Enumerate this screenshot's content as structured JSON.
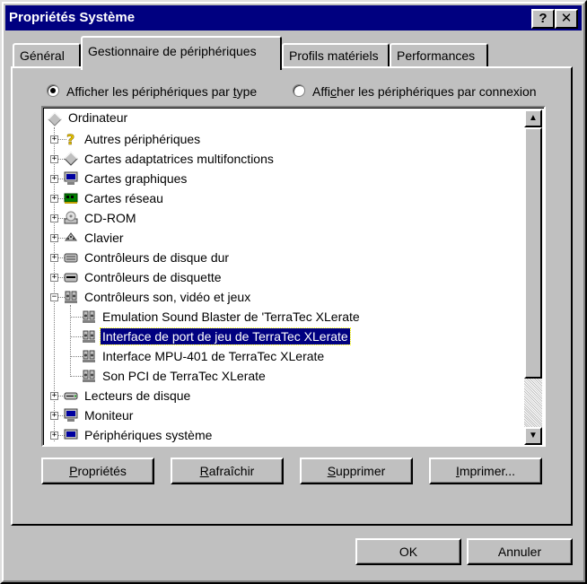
{
  "window": {
    "title": "Propriétés Système",
    "help_label": "?",
    "close_label": "✕"
  },
  "tabs": [
    {
      "label": "Général",
      "active": false
    },
    {
      "label": "Gestionnaire de périphériques",
      "active": true
    },
    {
      "label": "Profils matériels",
      "active": false
    },
    {
      "label": "Performances",
      "active": false
    }
  ],
  "view_options": {
    "by_type": {
      "pre": "Afficher les périphériques par ",
      "u": "t",
      "post": "ype",
      "checked": true
    },
    "by_connection": {
      "pre": "Affi",
      "u": "c",
      "post": "her les périphériques par connexion",
      "checked": false
    }
  },
  "tree": {
    "root": "Ordinateur",
    "items": [
      {
        "label": "Autres périphériques",
        "icon": "question-icon"
      },
      {
        "label": "Cartes adaptatrices multifonctions",
        "icon": "diamond-icon"
      },
      {
        "label": "Cartes graphiques",
        "icon": "monitor-icon"
      },
      {
        "label": "Cartes réseau",
        "icon": "network-card-icon"
      },
      {
        "label": "CD-ROM",
        "icon": "cdrom-icon"
      },
      {
        "label": "Clavier",
        "icon": "keyboard-icon"
      },
      {
        "label": "Contrôleurs de disque dur",
        "icon": "disk-controller-icon"
      },
      {
        "label": "Contrôleurs de disquette",
        "icon": "floppy-controller-icon"
      },
      {
        "label": "Contrôleurs son, vidéo et jeux",
        "icon": "sound-icon",
        "expanded": true
      },
      {
        "label": "Lecteurs de disque",
        "icon": "disk-drive-icon"
      },
      {
        "label": "Moniteur",
        "icon": "monitor-icon"
      },
      {
        "label": "Périphériques système",
        "icon": "system-icon"
      }
    ],
    "children": [
      {
        "label": "Emulation Sound Blaster de 'TerraTec XLerate",
        "selected": false
      },
      {
        "label": "Interface de port de jeu de TerraTec XLerate",
        "selected": true
      },
      {
        "label": "Interface MPU-401 de TerraTec XLerate",
        "selected": false
      },
      {
        "label": "Son PCI de TerraTec XLerate",
        "selected": false
      }
    ]
  },
  "buttons": {
    "properties": {
      "u": "P",
      "rest": "ropriétés"
    },
    "refresh": {
      "u": "R",
      "rest": "afraîchir"
    },
    "delete": {
      "u": "S",
      "rest": "upprimer"
    },
    "print": {
      "u": "I",
      "rest": "mprimer..."
    },
    "ok": "OK",
    "cancel": "Annuler"
  },
  "colors": {
    "titlebar": "#000080",
    "selection": "#000080",
    "face": "#c0c0c0"
  }
}
